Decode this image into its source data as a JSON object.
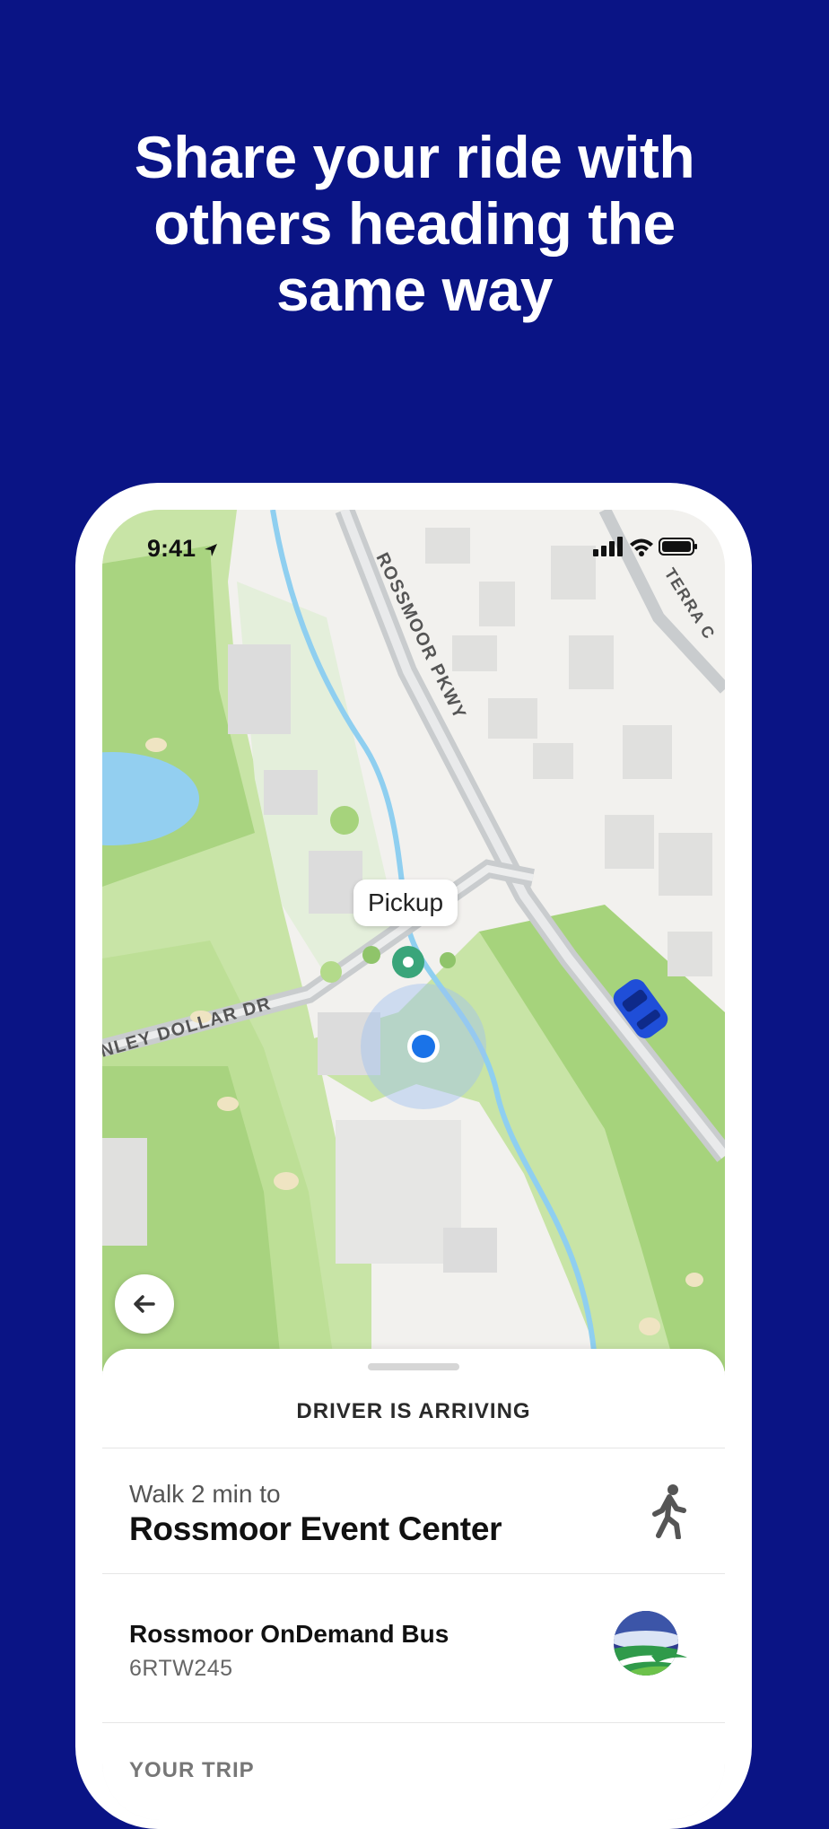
{
  "headline": {
    "line1": "Share your ride with",
    "line2": "others heading the",
    "line3": "same way"
  },
  "status_bar": {
    "time": "9:41",
    "icons": [
      "location-arrow-icon",
      "signal-icon",
      "wifi-icon",
      "battery-icon"
    ]
  },
  "map": {
    "street_labels": {
      "rossmoor": "ROSSMOOR PKWY",
      "terra": "TERRA C",
      "dollar": "NLEY DOLLAR DR"
    },
    "pickup_label": "Pickup",
    "colors": {
      "park": "#c5e3a0",
      "park_dark": "#a6d37c",
      "water": "#8fcff0",
      "road": "#cfd2d4",
      "pickup_pin": "#3aa57a",
      "user_dot": "#1a73e8",
      "vehicle": "#1f4ed8"
    }
  },
  "back_button_icon": "arrow-left-icon",
  "sheet": {
    "title": "DRIVER IS ARRIVING",
    "walk_subtitle": "Walk 2 min to",
    "walk_destination": "Rossmoor Event Center",
    "walk_icon": "walking-person-icon",
    "bus_name": "Rossmoor OnDemand Bus",
    "bus_plate": "6RTW245",
    "bus_logo_icon": "rossmoor-logo-icon",
    "trip_section": "YOUR TRIP"
  },
  "colors": {
    "background": "#0a1485",
    "headline_text": "#ffffff"
  }
}
